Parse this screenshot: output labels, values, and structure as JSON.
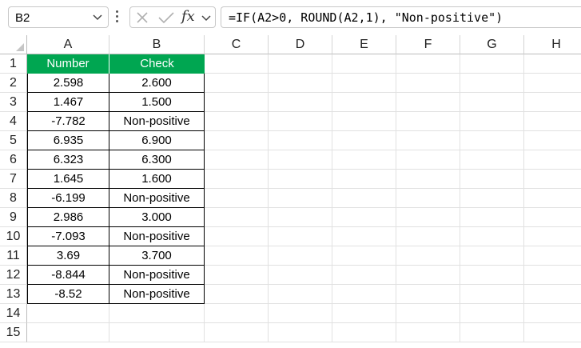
{
  "formula_bar": {
    "name_box": "B2",
    "fx_label": "fx",
    "formula": "=IF(A2>0, ROUND(A2,1), \"Non-positive\")"
  },
  "columns": [
    "A",
    "B",
    "C",
    "D",
    "E",
    "F",
    "G",
    "H"
  ],
  "rows": [
    "1",
    "2",
    "3",
    "4",
    "5",
    "6",
    "7",
    "8",
    "9",
    "10",
    "11",
    "12",
    "13",
    "14",
    "15"
  ],
  "table": {
    "headers": [
      "Number",
      "Check"
    ],
    "rows": [
      [
        "2.598",
        "2.600"
      ],
      [
        "1.467",
        "1.500"
      ],
      [
        "-7.782",
        "Non-positive"
      ],
      [
        "6.935",
        "6.900"
      ],
      [
        "6.323",
        "6.300"
      ],
      [
        "1.645",
        "1.600"
      ],
      [
        "-6.199",
        "Non-positive"
      ],
      [
        "2.986",
        "3.000"
      ],
      [
        "-7.093",
        "Non-positive"
      ],
      [
        "3.69",
        "3.700"
      ],
      [
        "-8.844",
        "Non-positive"
      ],
      [
        "-8.52",
        "Non-positive"
      ]
    ]
  },
  "colors": {
    "header_fill": "#00a651",
    "header_text": "#ffffff"
  }
}
